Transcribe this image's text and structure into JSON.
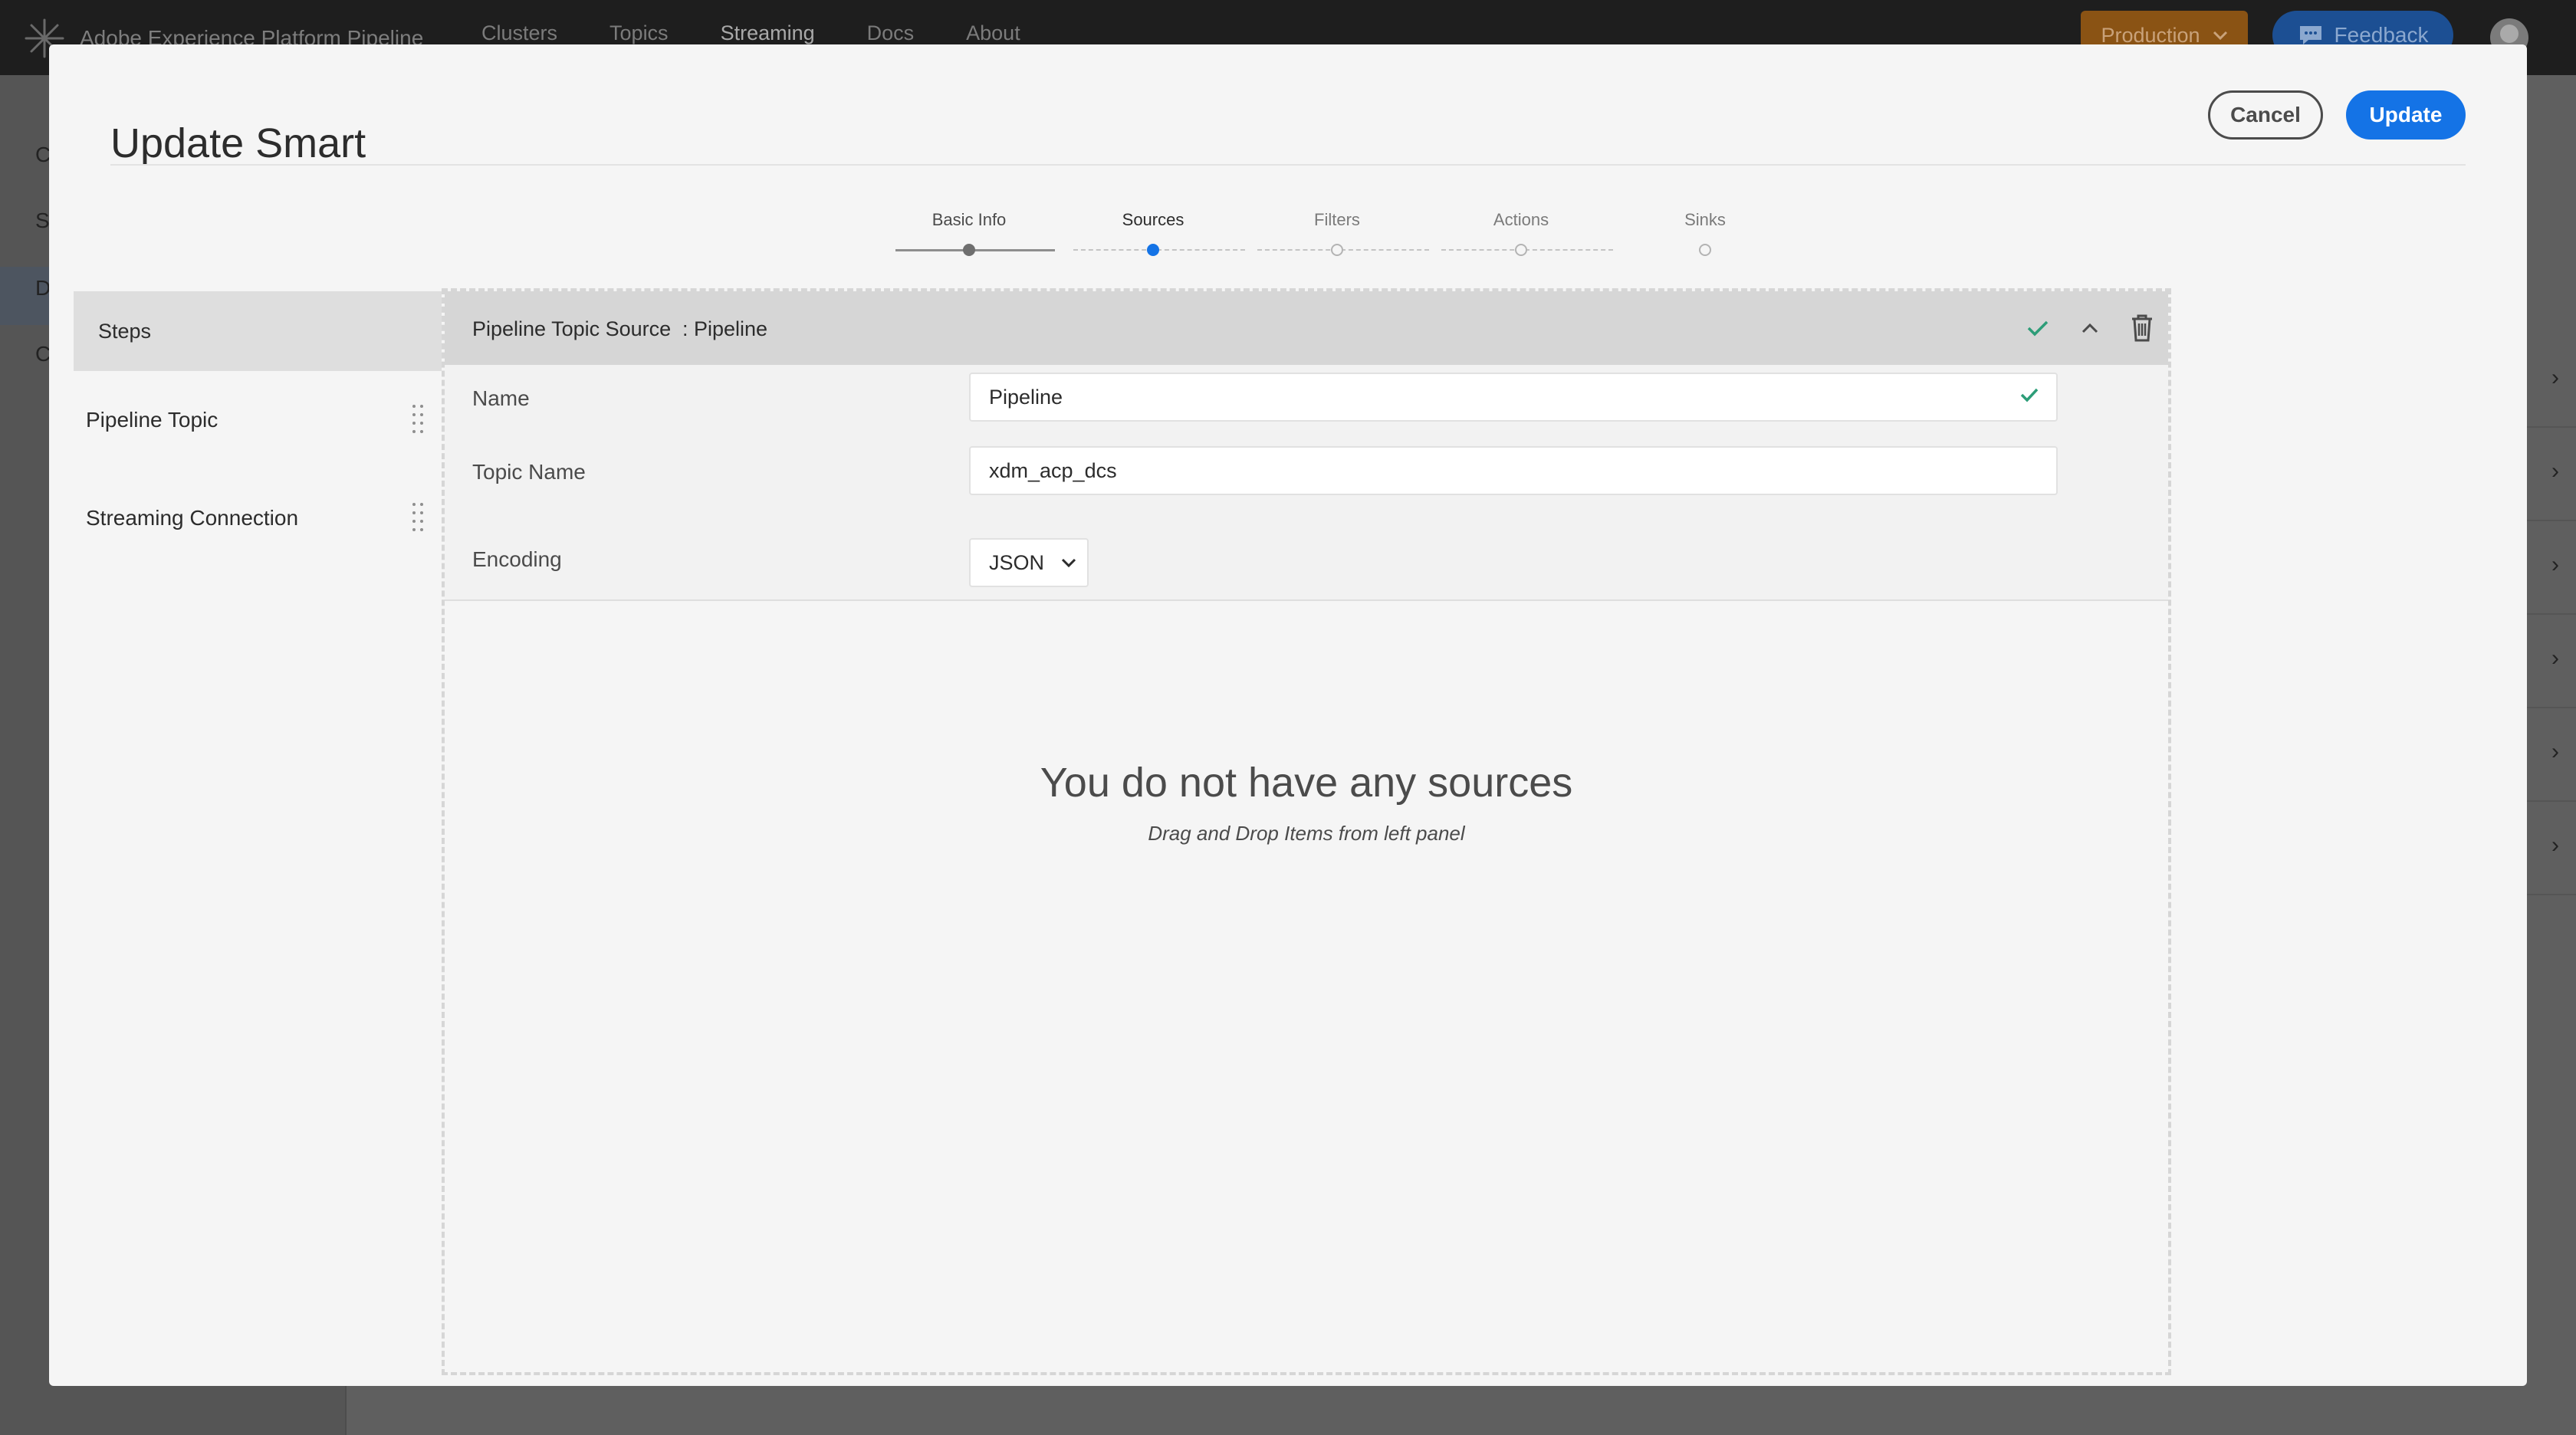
{
  "app": {
    "brand_name": "Adobe Experience Platform Pipeline",
    "nav": [
      "Clusters",
      "Topics",
      "Streaming",
      "Docs",
      "About"
    ],
    "active_nav": "Streaming",
    "environment": "Production",
    "feedback_label": "Feedback"
  },
  "background": {
    "sidebar_items": [
      "C",
      "S",
      "D",
      "C"
    ]
  },
  "modal": {
    "title": "Update Smart",
    "cancel_label": "Cancel",
    "update_label": "Update",
    "stepper": {
      "steps": [
        "Basic Info",
        "Sources",
        "Filters",
        "Actions",
        "Sinks"
      ],
      "current_index": 1
    },
    "steps_panel": {
      "header": "Steps",
      "items": [
        "Pipeline Topic",
        "Streaming Connection"
      ]
    },
    "source_card": {
      "title": "Pipeline Topic Source",
      "subtitle": ": Pipeline",
      "fields": {
        "name": {
          "label": "Name",
          "value": "Pipeline"
        },
        "topic_name": {
          "label": "Topic Name",
          "value": "xdm_acp_dcs"
        },
        "encoding": {
          "label": "Encoding",
          "value": "JSON"
        }
      }
    },
    "empty_state": {
      "title": "You do not have any sources",
      "subtitle": "Drag and Drop Items from left panel"
    },
    "colors": {
      "primary": "#1473e6",
      "valid_check": "#2d9d78"
    }
  }
}
